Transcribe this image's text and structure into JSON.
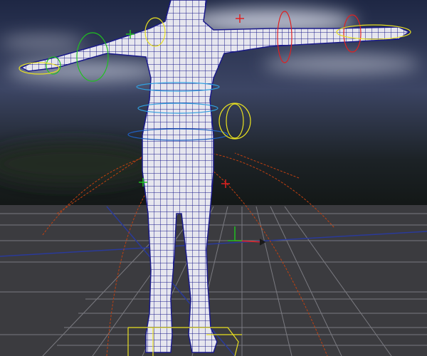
{
  "viewport": {
    "colors": {
      "sky_top": "#2a3350",
      "sky_mid": "#4a5068",
      "cloud": "#c8ccd6",
      "ground": "#3a3a3e",
      "grid": "#7a7a80",
      "grid_blue": "#2a3a9a",
      "mesh_fill": "#e8e8ee",
      "wire": "#1a1a8a",
      "ctrl_red": "#e02020",
      "ctrl_green": "#20c020",
      "ctrl_yellow": "#e8e020",
      "ctrl_cyan": "#30a0e0",
      "joint_orange": "#c04010"
    }
  }
}
